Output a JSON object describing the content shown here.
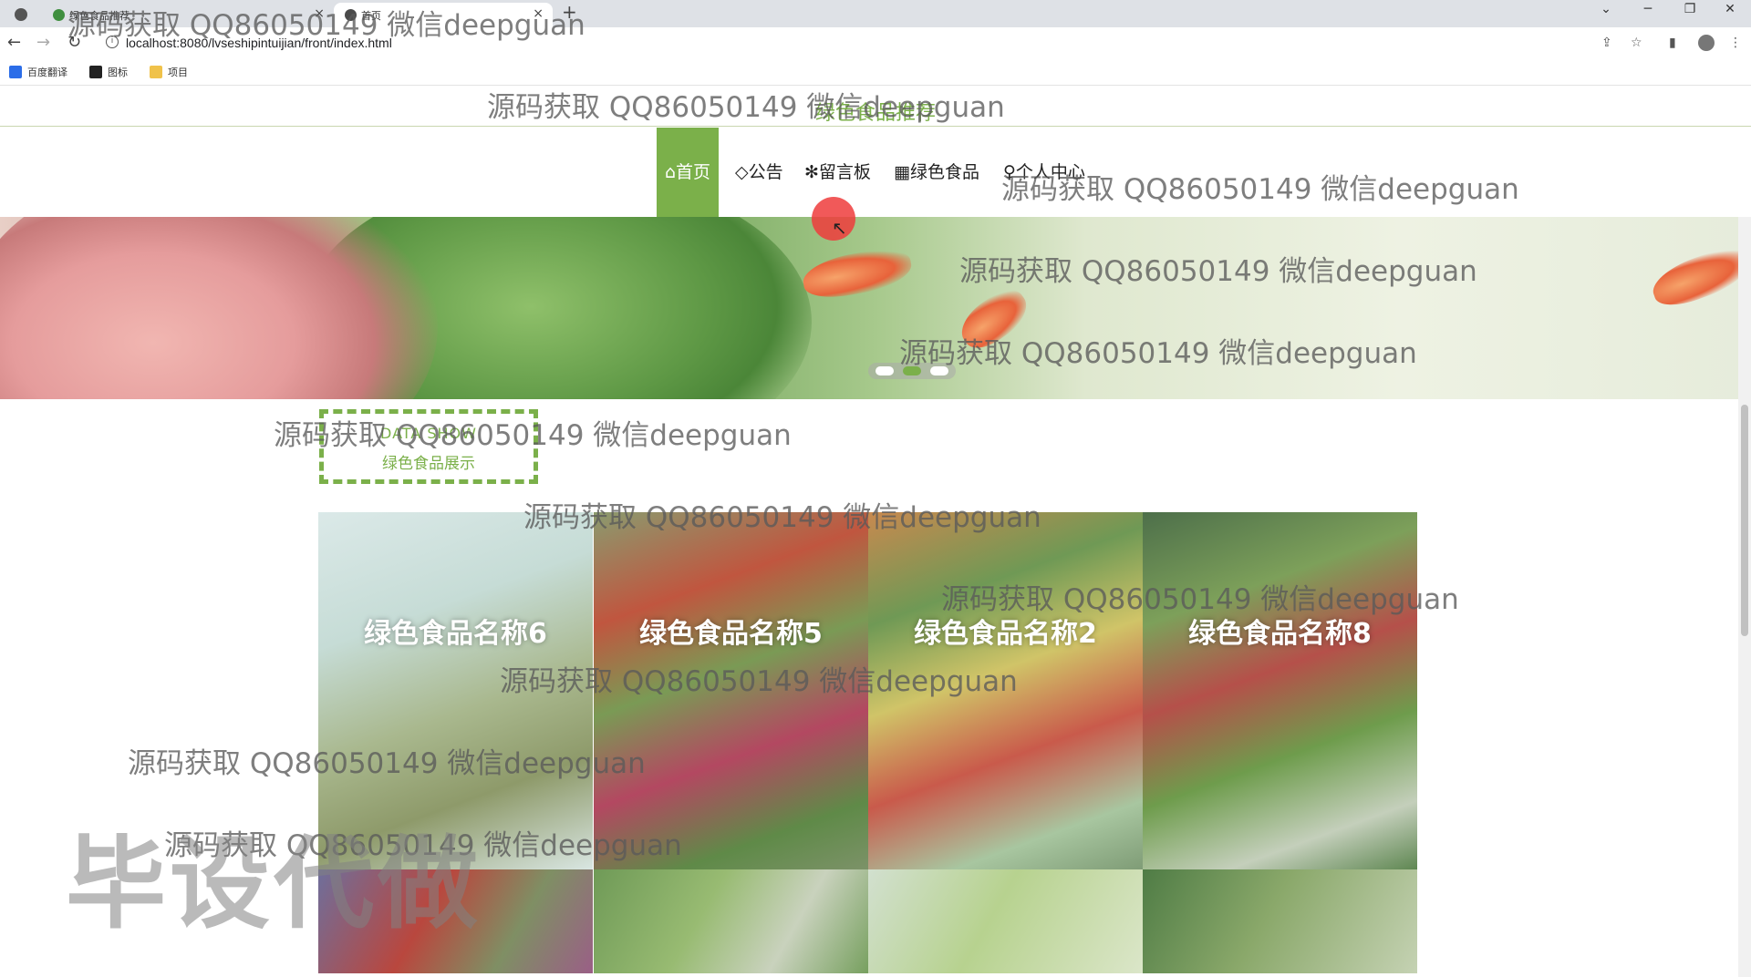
{
  "browser": {
    "tabs": [
      {
        "title": "绿色食品推荐",
        "close": "×"
      },
      {
        "title": "首页",
        "close": "×"
      }
    ],
    "new_tab": "+",
    "window_controls": [
      "⌄",
      "─",
      "❐",
      "✕"
    ],
    "url": "localhost:8080/lvseshipintuijian/front/index.html",
    "bookmarks": [
      {
        "label": "百度翻译",
        "color": "#2b6de8"
      },
      {
        "label": "图标",
        "color": "#222222"
      },
      {
        "label": "项目",
        "color": "#f0c24a"
      }
    ]
  },
  "site": {
    "title": "绿色食品推荐",
    "accent": "#7bb04a",
    "nav": [
      {
        "label": "⌂首页",
        "active": true
      },
      {
        "label": "◇公告",
        "active": false
      },
      {
        "label": "✻留言板",
        "active": false
      },
      {
        "label": "▦绿色食品",
        "active": false
      },
      {
        "label": "♀个人中心",
        "active": false
      }
    ]
  },
  "banner": {
    "slide_count": 3,
    "active_slide": 2
  },
  "section": {
    "english": "DATA SHOW",
    "title": "绿色食品展示"
  },
  "products": [
    {
      "name": "绿色食品名称6"
    },
    {
      "name": "绿色食品名称5"
    },
    {
      "name": "绿色食品名称2"
    },
    {
      "name": "绿色食品名称8"
    }
  ],
  "watermarks": {
    "repeated": "源码获取 QQ86050149 微信deepguan",
    "big": "毕设代做"
  }
}
